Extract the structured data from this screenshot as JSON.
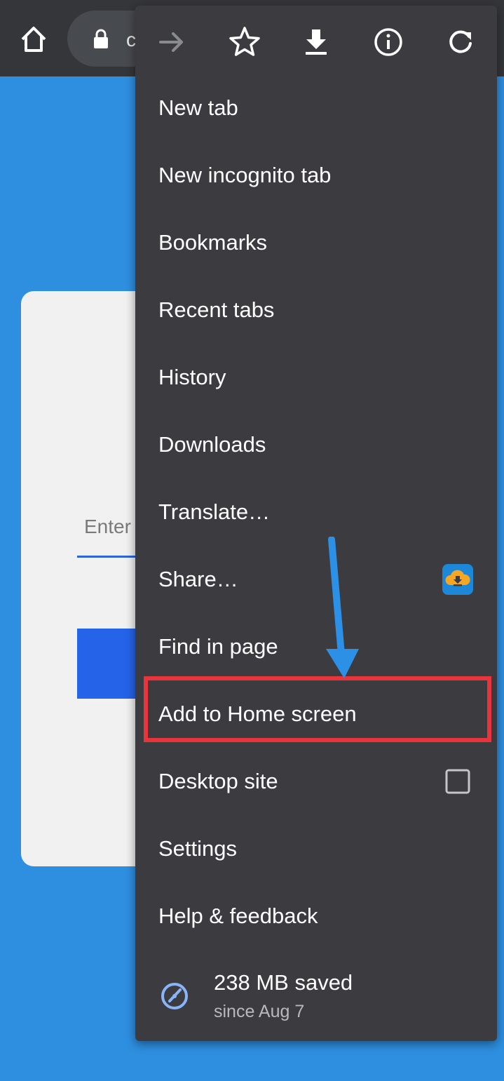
{
  "browser": {
    "url_partial": "c"
  },
  "page": {
    "input_placeholder": "Enter"
  },
  "menu": {
    "items": [
      {
        "label": "New tab"
      },
      {
        "label": "New incognito tab"
      },
      {
        "label": "Bookmarks"
      },
      {
        "label": "Recent tabs"
      },
      {
        "label": "History"
      },
      {
        "label": "Downloads"
      },
      {
        "label": "Translate…"
      },
      {
        "label": "Share…"
      },
      {
        "label": "Find in page"
      },
      {
        "label": "Add to Home screen"
      },
      {
        "label": "Desktop site"
      },
      {
        "label": "Settings"
      },
      {
        "label": "Help & feedback"
      }
    ],
    "desktop_site_checked": false,
    "savings": {
      "main": "238 MB saved",
      "sub": "since Aug 7"
    }
  },
  "colors": {
    "page_background": "#2e8fe0",
    "menu_background": "#3c3c40",
    "highlight": "#e8343a",
    "arrow": "#2b90e6"
  },
  "icons": [
    "home-icon",
    "lock-icon",
    "forward-icon",
    "star-icon",
    "download-icon",
    "info-icon",
    "refresh-icon",
    "cloud-download-icon",
    "checkbox-icon",
    "speedometer-icon"
  ]
}
